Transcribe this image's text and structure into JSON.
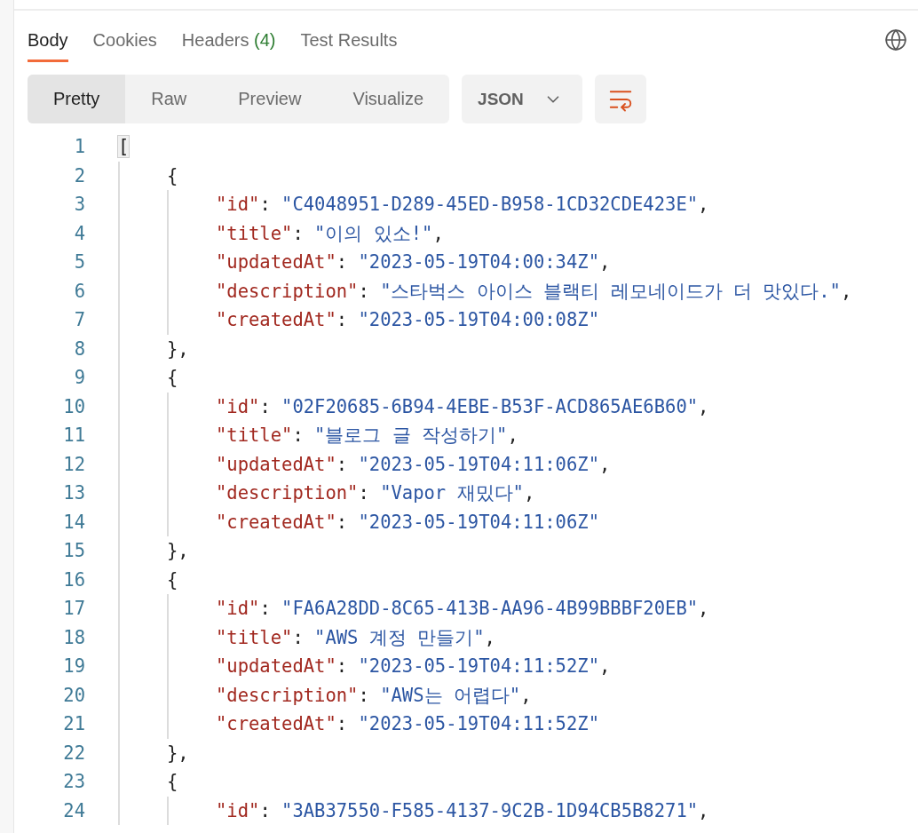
{
  "response_tabs": [
    {
      "label": "Body",
      "selected": true
    },
    {
      "label": "Cookies",
      "selected": false
    },
    {
      "label": "Headers",
      "count": "(4)",
      "selected": false
    },
    {
      "label": "Test Results",
      "selected": false
    }
  ],
  "view_modes": [
    {
      "label": "Pretty",
      "selected": true
    },
    {
      "label": "Raw",
      "selected": false
    },
    {
      "label": "Preview",
      "selected": false
    },
    {
      "label": "Visualize",
      "selected": false
    }
  ],
  "format_dropdown": {
    "value": "JSON"
  },
  "wrap_lines": {
    "on": true
  },
  "code_lines": [
    {
      "number": "1",
      "tokens": [
        {
          "kind": "matched",
          "text": "["
        }
      ],
      "children": [
        {
          "number": "2",
          "tokens": [
            {
              "kind": "punct",
              "text": "{"
            }
          ],
          "children": [
            {
              "number": "3",
              "tokens": [
                {
                  "kind": "key",
                  "text": "\"id\""
                },
                {
                  "kind": "punct",
                  "text": ": "
                },
                {
                  "kind": "string",
                  "text": "\"C4048951-D289-45ED-B958-1CD32CDE423E\""
                },
                {
                  "kind": "punct",
                  "text": ","
                }
              ]
            },
            {
              "number": "4",
              "tokens": [
                {
                  "kind": "key",
                  "text": "\"title\""
                },
                {
                  "kind": "punct",
                  "text": ": "
                },
                {
                  "kind": "string",
                  "text": "\"이의 있소!\""
                },
                {
                  "kind": "punct",
                  "text": ","
                }
              ]
            },
            {
              "number": "5",
              "tokens": [
                {
                  "kind": "key",
                  "text": "\"updatedAt\""
                },
                {
                  "kind": "punct",
                  "text": ": "
                },
                {
                  "kind": "string",
                  "text": "\"2023-05-19T04:00:34Z\""
                },
                {
                  "kind": "punct",
                  "text": ","
                }
              ]
            },
            {
              "number": "6",
              "tokens": [
                {
                  "kind": "key",
                  "text": "\"description\""
                },
                {
                  "kind": "punct",
                  "text": ": "
                },
                {
                  "kind": "string",
                  "text": "\"스타벅스 아이스 블랙티 레모네이드가 더 맛있다.\""
                },
                {
                  "kind": "punct",
                  "text": ","
                }
              ]
            },
            {
              "number": "7",
              "tokens": [
                {
                  "kind": "key",
                  "text": "\"createdAt\""
                },
                {
                  "kind": "punct",
                  "text": ": "
                },
                {
                  "kind": "string",
                  "text": "\"2023-05-19T04:00:08Z\""
                }
              ]
            }
          ]
        },
        {
          "number": "8",
          "tokens": [
            {
              "kind": "punct",
              "text": "},"
            }
          ]
        },
        {
          "number": "9",
          "tokens": [
            {
              "kind": "punct",
              "text": "{"
            }
          ],
          "children": [
            {
              "number": "10",
              "tokens": [
                {
                  "kind": "key",
                  "text": "\"id\""
                },
                {
                  "kind": "punct",
                  "text": ": "
                },
                {
                  "kind": "string",
                  "text": "\"02F20685-6B94-4EBE-B53F-ACD865AE6B60\""
                },
                {
                  "kind": "punct",
                  "text": ","
                }
              ]
            },
            {
              "number": "11",
              "tokens": [
                {
                  "kind": "key",
                  "text": "\"title\""
                },
                {
                  "kind": "punct",
                  "text": ": "
                },
                {
                  "kind": "string",
                  "text": "\"블로그 글 작성하기\""
                },
                {
                  "kind": "punct",
                  "text": ","
                }
              ]
            },
            {
              "number": "12",
              "tokens": [
                {
                  "kind": "key",
                  "text": "\"updatedAt\""
                },
                {
                  "kind": "punct",
                  "text": ": "
                },
                {
                  "kind": "string",
                  "text": "\"2023-05-19T04:11:06Z\""
                },
                {
                  "kind": "punct",
                  "text": ","
                }
              ]
            },
            {
              "number": "13",
              "tokens": [
                {
                  "kind": "key",
                  "text": "\"description\""
                },
                {
                  "kind": "punct",
                  "text": ": "
                },
                {
                  "kind": "string",
                  "text": "\"Vapor 재밌다\""
                },
                {
                  "kind": "punct",
                  "text": ","
                }
              ]
            },
            {
              "number": "14",
              "tokens": [
                {
                  "kind": "key",
                  "text": "\"createdAt\""
                },
                {
                  "kind": "punct",
                  "text": ": "
                },
                {
                  "kind": "string",
                  "text": "\"2023-05-19T04:11:06Z\""
                }
              ]
            }
          ]
        },
        {
          "number": "15",
          "tokens": [
            {
              "kind": "punct",
              "text": "},"
            }
          ]
        },
        {
          "number": "16",
          "tokens": [
            {
              "kind": "punct",
              "text": "{"
            }
          ],
          "children": [
            {
              "number": "17",
              "tokens": [
                {
                  "kind": "key",
                  "text": "\"id\""
                },
                {
                  "kind": "punct",
                  "text": ": "
                },
                {
                  "kind": "string",
                  "text": "\"FA6A28DD-8C65-413B-AA96-4B99BBBF20EB\""
                },
                {
                  "kind": "punct",
                  "text": ","
                }
              ]
            },
            {
              "number": "18",
              "tokens": [
                {
                  "kind": "key",
                  "text": "\"title\""
                },
                {
                  "kind": "punct",
                  "text": ": "
                },
                {
                  "kind": "string",
                  "text": "\"AWS 계정 만들기\""
                },
                {
                  "kind": "punct",
                  "text": ","
                }
              ]
            },
            {
              "number": "19",
              "tokens": [
                {
                  "kind": "key",
                  "text": "\"updatedAt\""
                },
                {
                  "kind": "punct",
                  "text": ": "
                },
                {
                  "kind": "string",
                  "text": "\"2023-05-19T04:11:52Z\""
                },
                {
                  "kind": "punct",
                  "text": ","
                }
              ]
            },
            {
              "number": "20",
              "tokens": [
                {
                  "kind": "key",
                  "text": "\"description\""
                },
                {
                  "kind": "punct",
                  "text": ": "
                },
                {
                  "kind": "string",
                  "text": "\"AWS는 어렵다\""
                },
                {
                  "kind": "punct",
                  "text": ","
                }
              ]
            },
            {
              "number": "21",
              "tokens": [
                {
                  "kind": "key",
                  "text": "\"createdAt\""
                },
                {
                  "kind": "punct",
                  "text": ": "
                },
                {
                  "kind": "string",
                  "text": "\"2023-05-19T04:11:52Z\""
                }
              ]
            }
          ]
        },
        {
          "number": "22",
          "tokens": [
            {
              "kind": "punct",
              "text": "},"
            }
          ]
        },
        {
          "number": "23",
          "tokens": [
            {
              "kind": "punct",
              "text": "{"
            }
          ],
          "children": [
            {
              "number": "24",
              "tokens": [
                {
                  "kind": "key",
                  "text": "\"id\""
                },
                {
                  "kind": "punct",
                  "text": ": "
                },
                {
                  "kind": "string",
                  "text": "\"3AB37550-F585-4137-9C2B-1D94CB5B8271\""
                },
                {
                  "kind": "punct",
                  "text": ","
                }
              ]
            }
          ]
        }
      ]
    }
  ]
}
